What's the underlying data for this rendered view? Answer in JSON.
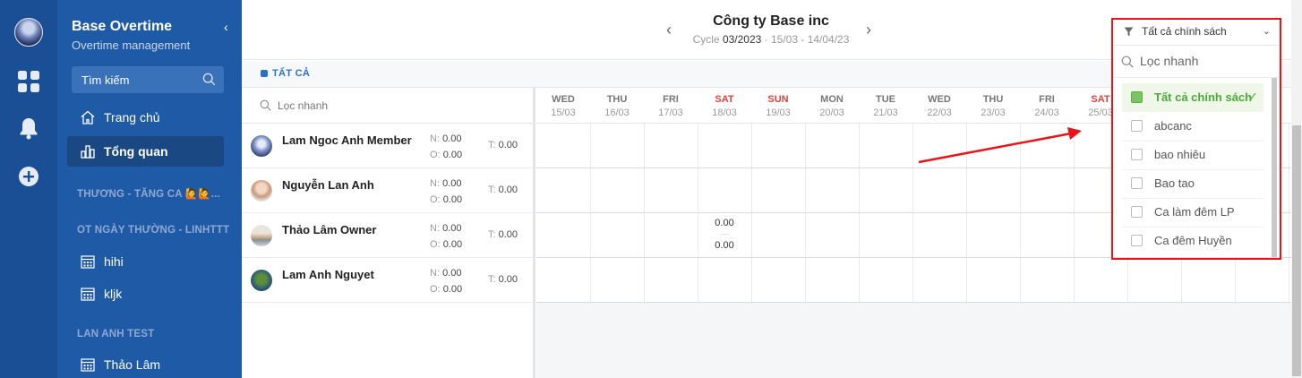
{
  "app": {
    "title": "Base Overtime",
    "subtitle": "Overtime management"
  },
  "sidebar": {
    "search_label": "Tìm kiếm",
    "items": [
      {
        "label": "Trang chủ"
      },
      {
        "label": "Tổng quan",
        "active": true
      }
    ],
    "sections": [
      {
        "title": "THƯƠNG - TĂNG CA 🙋🙋...",
        "items": []
      },
      {
        "title": "OT NGÀY THƯỜNG - LINHTTT",
        "items": [
          {
            "label": "hihi"
          },
          {
            "label": "kljk"
          }
        ]
      },
      {
        "title": "LAN ANH TEST",
        "items": [
          {
            "label": "Thảo Lâm"
          }
        ]
      }
    ]
  },
  "header": {
    "company": "Công ty Base inc",
    "cycle_prefix": "Cycle",
    "cycle_code": "03/2023",
    "cycle_range": "· 15/03 - 14/04/23"
  },
  "tabs": {
    "all": "TẤT CẢ"
  },
  "people_search_placeholder": "Lọc nhanh",
  "labels": {
    "n": "N:",
    "o": "O:",
    "t": "T:"
  },
  "people": [
    {
      "name": "Lam Ngoc Anh Member",
      "n": "0.00",
      "o": "0.00",
      "t": "0.00"
    },
    {
      "name": "Nguyễn Lan Anh",
      "n": "0.00",
      "o": "0.00",
      "t": "0.00"
    },
    {
      "name": "Thảo Lâm Owner",
      "n": "0.00",
      "o": "0.00",
      "t": "0.00"
    },
    {
      "name": "Lam Anh Nguyet",
      "n": "0.00",
      "o": "0.00",
      "t": "0.00"
    }
  ],
  "days": [
    {
      "name": "WED",
      "date": "15/03",
      "weekend": false
    },
    {
      "name": "THU",
      "date": "16/03",
      "weekend": false
    },
    {
      "name": "FRI",
      "date": "17/03",
      "weekend": false
    },
    {
      "name": "SAT",
      "date": "18/03",
      "weekend": true
    },
    {
      "name": "SUN",
      "date": "19/03",
      "weekend": true
    },
    {
      "name": "MON",
      "date": "20/03",
      "weekend": false
    },
    {
      "name": "TUE",
      "date": "21/03",
      "weekend": false
    },
    {
      "name": "WED",
      "date": "22/03",
      "weekend": false
    },
    {
      "name": "THU",
      "date": "23/03",
      "weekend": false
    },
    {
      "name": "FRI",
      "date": "24/03",
      "weekend": false
    },
    {
      "name": "SAT",
      "date": "25/03",
      "weekend": true
    }
  ],
  "cell_values": {
    "top": "0.00",
    "sep": "—",
    "bottom": "0.00"
  },
  "filter": {
    "selected_label": "Tất cả chính sách",
    "search_placeholder": "Lọc nhanh",
    "options": [
      {
        "label": "Tất cả chính sách",
        "selected": true,
        "check": "✓"
      },
      {
        "label": "abcanc",
        "selected": false
      },
      {
        "label": "bao nhiêu",
        "selected": false
      },
      {
        "label": "Bao tao",
        "selected": false
      },
      {
        "label": "Ca làm đêm LP",
        "selected": false
      },
      {
        "label": "Ca đêm Huyền",
        "selected": false
      }
    ]
  },
  "colors": {
    "sidebar": "#1f5aa6",
    "rail": "#1a4f96",
    "accent": "#2a6fd0",
    "weekend": "#e0423c",
    "selected": "#4ca93a",
    "annotation": "#e8141a"
  }
}
